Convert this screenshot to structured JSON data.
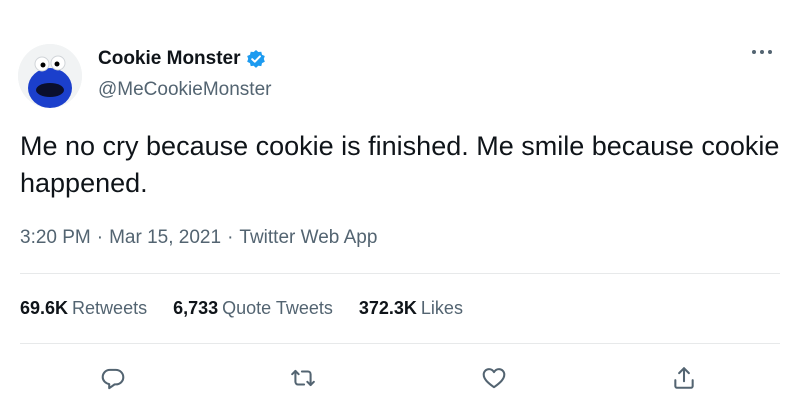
{
  "author": {
    "display_name": "Cookie Monster",
    "handle": "@MeCookieMonster",
    "verified": true,
    "avatar_icon": "cookie-monster-avatar"
  },
  "tweet": {
    "text": "Me no cry because cookie is finished. Me smile because cookie happened."
  },
  "meta": {
    "time": "3:20 PM",
    "separator": "·",
    "date": "Mar 15, 2021",
    "app": "Twitter Web App"
  },
  "stats": {
    "retweets": {
      "count": "69.6K",
      "label": "Retweets"
    },
    "quote_tweets": {
      "count": "6,733",
      "label": "Quote Tweets"
    },
    "likes": {
      "count": "372.3K",
      "label": "Likes"
    }
  },
  "actions": [
    {
      "name": "reply",
      "icon": "reply-icon"
    },
    {
      "name": "retweet",
      "icon": "retweet-icon"
    },
    {
      "name": "like",
      "icon": "heart-icon"
    },
    {
      "name": "share",
      "icon": "share-icon"
    }
  ],
  "colors": {
    "text_primary": "#0f1419",
    "text_secondary": "#536471",
    "verified_blue": "#1d9bf0",
    "divider": "#e7e9ea",
    "avatar_blue": "#1b3fcc"
  }
}
